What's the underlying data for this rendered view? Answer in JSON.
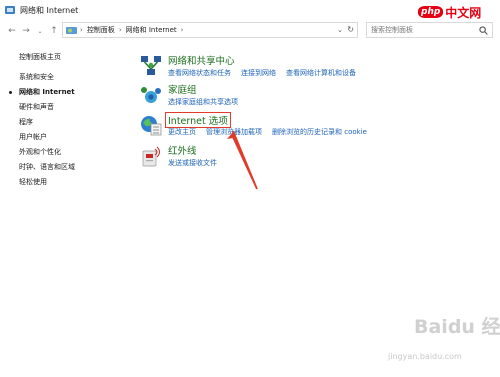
{
  "window": {
    "title": "网络和 Internet"
  },
  "watermarks": {
    "php_badge": "php",
    "php_text": "中文网",
    "baidu_logo": "Baidu 经验",
    "baidu_url": "jingyan.baidu.com"
  },
  "toolbar": {
    "back_icon": "left-arrow-icon",
    "forward_icon": "right-arrow-icon",
    "recent_icon": "chevron-down-icon",
    "up_icon": "up-arrow-icon",
    "breadcrumb": [
      "控制面板",
      "网络和 Internet"
    ],
    "search_placeholder": "搜索控制面板"
  },
  "sidebar": {
    "items": [
      {
        "label": "控制面板主页"
      },
      {
        "label": "系统和安全"
      },
      {
        "label": "网络和 Internet"
      },
      {
        "label": "硬件和声音"
      },
      {
        "label": "程序"
      },
      {
        "label": "用户帐户"
      },
      {
        "label": "外观和个性化"
      },
      {
        "label": "时钟、语言和区域"
      },
      {
        "label": "轻松使用"
      }
    ]
  },
  "categories": [
    {
      "title": "网络和共享中心",
      "icon": "network-icon",
      "links": [
        "查看网络状态和任务",
        "连接到网络",
        "查看网络计算机和设备"
      ]
    },
    {
      "title": "家庭组",
      "icon": "homegroup-icon",
      "links": [
        "选择家庭组和共享选项"
      ]
    },
    {
      "title": "Internet 选项",
      "icon": "internet-options-icon",
      "links": [
        "更改主页",
        "管理浏览器加载项",
        "删除浏览的历史记录和 cookie"
      ]
    },
    {
      "title": "红外线",
      "icon": "infrared-icon",
      "links": [
        "发送或接收文件"
      ]
    }
  ],
  "colors": {
    "category_title": "#1e6e1e",
    "link": "#1c62b7",
    "annotation": "#e23b2b"
  }
}
